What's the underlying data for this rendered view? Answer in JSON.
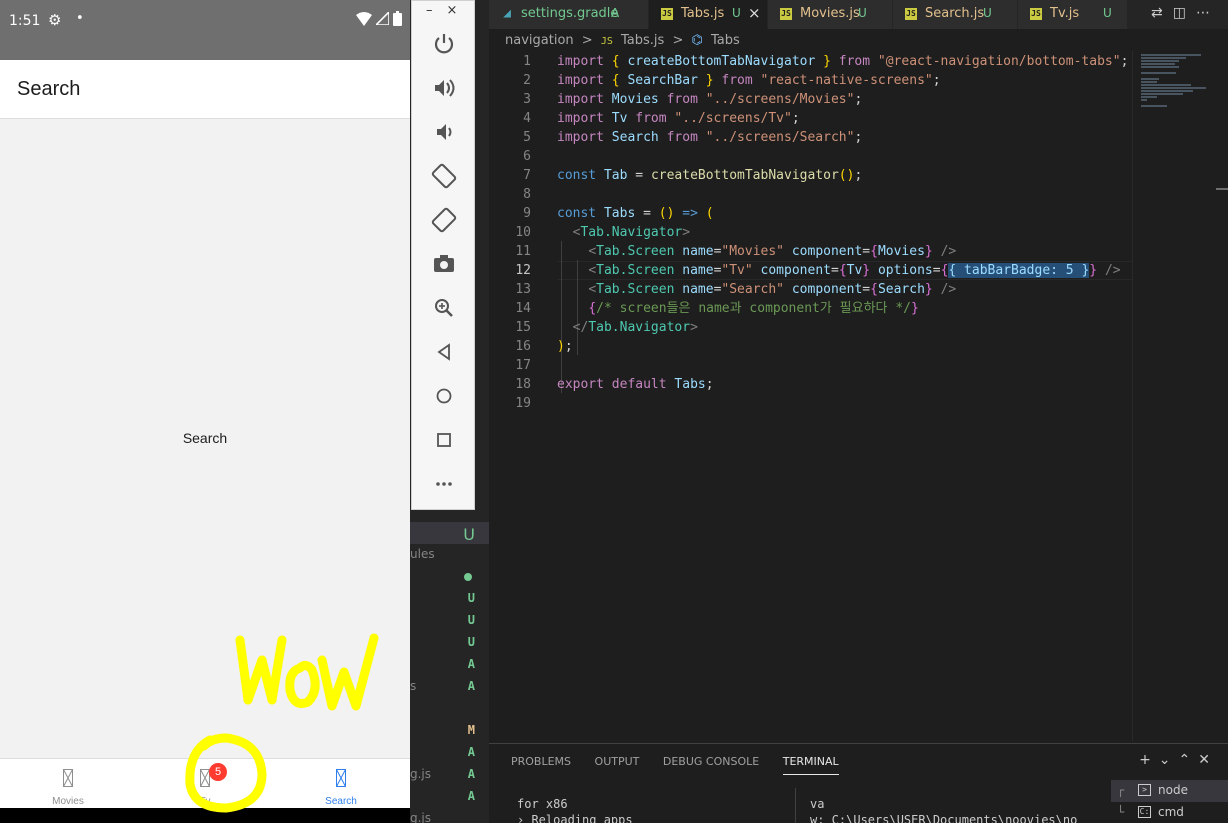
{
  "phone": {
    "status": {
      "time": "1:51"
    },
    "header_title": "Search",
    "center_text": "Search",
    "tabs": [
      {
        "label": "Movies",
        "active": false
      },
      {
        "label": "Tv",
        "active": false,
        "badge": "5"
      },
      {
        "label": "Search",
        "active": true
      }
    ],
    "annotation_text": "WoW"
  },
  "emulator_toolbar": {
    "window_controls": [
      "–",
      "×"
    ],
    "buttons": [
      "power-icon",
      "volume-up-icon",
      "volume-down-icon",
      "rotate-left-icon",
      "rotate-right-icon",
      "camera-icon",
      "zoom-icon",
      "back-icon",
      "home-icon",
      "overview-icon",
      "more-icon"
    ]
  },
  "vscode": {
    "tabs": [
      {
        "label": "settings.gradle",
        "badge": "A",
        "icon": "gradle-icon"
      },
      {
        "label": "Tabs.js",
        "badge": "U",
        "active": true,
        "icon": "js-icon"
      },
      {
        "label": "Movies.js",
        "badge": "U",
        "icon": "js-icon"
      },
      {
        "label": "Search.js",
        "badge": "U",
        "icon": "js-icon"
      },
      {
        "label": "Tv.js",
        "badge": "U",
        "icon": "js-icon"
      }
    ],
    "breadcrumb": [
      "navigation",
      ">",
      "Tabs.js",
      ">",
      "Tabs"
    ],
    "explorer": {
      "partial_labels": [
        "ules",
        "s",
        "g.js",
        "g.js"
      ],
      "statuses": [
        "U",
        "U",
        "U",
        "U",
        "A",
        "A",
        "M",
        "A",
        "A",
        "A"
      ]
    },
    "current_line": 12,
    "code": [
      [
        [
          "kw",
          "import"
        ],
        [
          "txt",
          " "
        ],
        [
          "br",
          "{"
        ],
        [
          "txt",
          " "
        ],
        [
          "id",
          "createBottomTabNavigator"
        ],
        [
          "txt",
          " "
        ],
        [
          "br",
          "}"
        ],
        [
          "txt",
          " "
        ],
        [
          "kw",
          "from"
        ],
        [
          "txt",
          " "
        ],
        [
          "str",
          "\"@react-navigation/bottom-tabs\""
        ],
        [
          "txt",
          ";"
        ]
      ],
      [
        [
          "kw",
          "import"
        ],
        [
          "txt",
          " "
        ],
        [
          "br",
          "{"
        ],
        [
          "txt",
          " "
        ],
        [
          "id",
          "SearchBar"
        ],
        [
          "txt",
          " "
        ],
        [
          "br",
          "}"
        ],
        [
          "txt",
          " "
        ],
        [
          "kw",
          "from"
        ],
        [
          "txt",
          " "
        ],
        [
          "str",
          "\"react-native-screens\""
        ],
        [
          "txt",
          ";"
        ]
      ],
      [
        [
          "kw",
          "import"
        ],
        [
          "txt",
          " "
        ],
        [
          "id",
          "Movies"
        ],
        [
          "txt",
          " "
        ],
        [
          "kw",
          "from"
        ],
        [
          "txt",
          " "
        ],
        [
          "str",
          "\"../screens/Movies\""
        ],
        [
          "txt",
          ";"
        ]
      ],
      [
        [
          "kw",
          "import"
        ],
        [
          "txt",
          " "
        ],
        [
          "id",
          "Tv"
        ],
        [
          "txt",
          " "
        ],
        [
          "kw",
          "from"
        ],
        [
          "txt",
          " "
        ],
        [
          "str",
          "\"../screens/Tv\""
        ],
        [
          "txt",
          ";"
        ]
      ],
      [
        [
          "kw",
          "import"
        ],
        [
          "txt",
          " "
        ],
        [
          "id",
          "Search"
        ],
        [
          "txt",
          " "
        ],
        [
          "kw",
          "from"
        ],
        [
          "txt",
          " "
        ],
        [
          "str",
          "\"../screens/Search\""
        ],
        [
          "txt",
          ";"
        ]
      ],
      [],
      [
        [
          "kw2",
          "const"
        ],
        [
          "txt",
          " "
        ],
        [
          "id",
          "Tab"
        ],
        [
          "txt",
          " = "
        ],
        [
          "fn",
          "createBottomTabNavigator"
        ],
        [
          "br",
          "()"
        ],
        [
          "txt",
          ";"
        ]
      ],
      [],
      [
        [
          "kw2",
          "const"
        ],
        [
          "txt",
          " "
        ],
        [
          "id",
          "Tabs"
        ],
        [
          "txt",
          " = "
        ],
        [
          "br",
          "()"
        ],
        [
          "txt",
          " "
        ],
        [
          "kw2",
          "=>"
        ],
        [
          "txt",
          " "
        ],
        [
          "br",
          "("
        ]
      ],
      [
        [
          "txt",
          "  "
        ],
        [
          "pn",
          "<"
        ],
        [
          "tag",
          "Tab.Navigator"
        ],
        [
          "pn",
          ">"
        ]
      ],
      [
        [
          "txt",
          "    "
        ],
        [
          "pn",
          "<"
        ],
        [
          "tag",
          "Tab.Screen"
        ],
        [
          "txt",
          " "
        ],
        [
          "attr",
          "name"
        ],
        [
          "txt",
          "="
        ],
        [
          "str",
          "\"Movies\""
        ],
        [
          "txt",
          " "
        ],
        [
          "attr",
          "component"
        ],
        [
          "txt",
          "="
        ],
        [
          "br2",
          "{"
        ],
        [
          "id",
          "Movies"
        ],
        [
          "br2",
          "}"
        ],
        [
          "txt",
          " "
        ],
        [
          "pn",
          "/>"
        ]
      ],
      [
        [
          "txt",
          "    "
        ],
        [
          "pn",
          "<"
        ],
        [
          "tag",
          "Tab.Screen"
        ],
        [
          "txt",
          " "
        ],
        [
          "attr",
          "name"
        ],
        [
          "txt",
          "="
        ],
        [
          "str",
          "\"Tv\""
        ],
        [
          "txt",
          " "
        ],
        [
          "attr",
          "component"
        ],
        [
          "txt",
          "="
        ],
        [
          "br2",
          "{"
        ],
        [
          "id",
          "Tv"
        ],
        [
          "br2",
          "}"
        ],
        [
          "txt",
          " "
        ],
        [
          "attr",
          "options"
        ],
        [
          "txt",
          "="
        ],
        [
          "br2",
          "{"
        ],
        [
          "hl",
          "{ tabBarBadge: 5 }"
        ],
        [
          "br2",
          "}"
        ],
        [
          "txt",
          " "
        ],
        [
          "pn",
          "/>"
        ]
      ],
      [
        [
          "txt",
          "    "
        ],
        [
          "pn",
          "<"
        ],
        [
          "tag",
          "Tab.Screen"
        ],
        [
          "txt",
          " "
        ],
        [
          "attr",
          "name"
        ],
        [
          "txt",
          "="
        ],
        [
          "str",
          "\"Search\""
        ],
        [
          "txt",
          " "
        ],
        [
          "attr",
          "component"
        ],
        [
          "txt",
          "="
        ],
        [
          "br2",
          "{"
        ],
        [
          "id",
          "Search"
        ],
        [
          "br2",
          "}"
        ],
        [
          "txt",
          " "
        ],
        [
          "pn",
          "/>"
        ]
      ],
      [
        [
          "txt",
          "    "
        ],
        [
          "br2",
          "{"
        ],
        [
          "cm",
          "/* screen들은 name과 component가 필요하다 */"
        ],
        [
          "br2",
          "}"
        ]
      ],
      [
        [
          "txt",
          "  "
        ],
        [
          "pn",
          "</"
        ],
        [
          "tag",
          "Tab.Navigator"
        ],
        [
          "pn",
          ">"
        ]
      ],
      [
        [
          "br",
          ")"
        ],
        [
          "txt",
          ";"
        ]
      ],
      [],
      [
        [
          "kw",
          "export"
        ],
        [
          "txt",
          " "
        ],
        [
          "kw",
          "default"
        ],
        [
          "txt",
          " "
        ],
        [
          "id",
          "Tabs"
        ],
        [
          "txt",
          ";"
        ]
      ],
      []
    ],
    "panel": {
      "tabs": [
        "PROBLEMS",
        "OUTPUT",
        "DEBUG CONSOLE",
        "TERMINAL"
      ],
      "active_tab": "TERMINAL",
      "terminal_left": [
        "for x86",
        "› Reloading apps"
      ],
      "terminal_right": [
        "va",
        "w: C:\\Users\\USER\\Documents\\noovies\\no"
      ],
      "terminals": [
        "node",
        "cmd"
      ]
    }
  }
}
